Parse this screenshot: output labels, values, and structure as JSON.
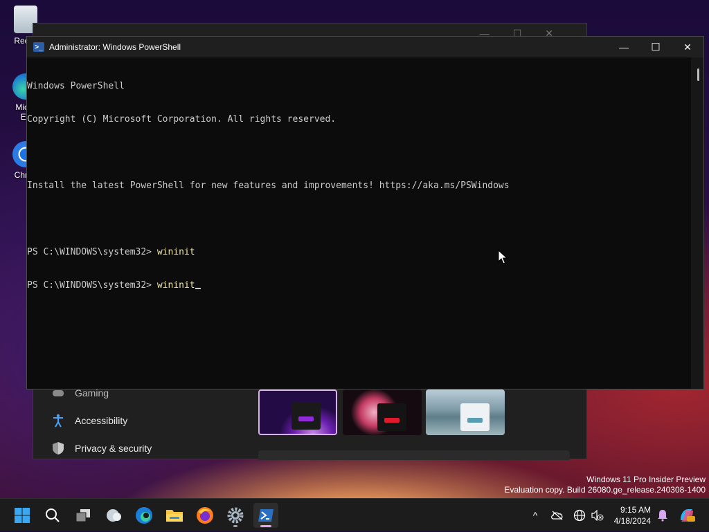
{
  "desktop": {
    "icons": [
      {
        "label": "Recyc"
      },
      {
        "label": "Micro"
      },
      {
        "label": "Ed"
      },
      {
        "label": "Chron"
      }
    ]
  },
  "settings_window": {
    "nav_items": [
      {
        "label": "Gaming",
        "icon": "gaming-icon"
      },
      {
        "label": "Accessibility",
        "icon": "accessibility-icon"
      },
      {
        "label": "Privacy & security",
        "icon": "shield-icon"
      }
    ],
    "controls": [
      "—",
      "☐",
      "✕"
    ]
  },
  "powershell": {
    "title": "Administrator: Windows PowerShell",
    "lines": [
      {
        "text": "Windows PowerShell",
        "cmd": ""
      },
      {
        "text": "Copyright (C) Microsoft Corporation. All rights reserved.",
        "cmd": ""
      },
      {
        "text": "",
        "cmd": ""
      },
      {
        "text": "Install the latest PowerShell for new features and improvements! https://aka.ms/PSWindows",
        "cmd": ""
      },
      {
        "text": "",
        "cmd": ""
      },
      {
        "text": "PS C:\\WINDOWS\\system32> ",
        "cmd": "wininit"
      },
      {
        "text": "PS C:\\WINDOWS\\system32> ",
        "cmd": "wininit"
      }
    ],
    "controls": {
      "minimize": "—",
      "maximize": "☐",
      "close": "✕"
    }
  },
  "watermark": {
    "line1": "Windows 11 Pro Insider Preview",
    "line2": "Evaluation copy. Build 26080.ge_release.240308-1400"
  },
  "taskbar": {
    "apps": [
      {
        "name": "start-button",
        "icon": "windows-logo-icon"
      },
      {
        "name": "search-button",
        "icon": "search-icon"
      },
      {
        "name": "task-view-button",
        "icon": "task-view-icon"
      },
      {
        "name": "widgets-button",
        "icon": "weather-icon"
      },
      {
        "name": "edge-button",
        "icon": "edge-icon"
      },
      {
        "name": "file-explorer-button",
        "icon": "folder-icon"
      },
      {
        "name": "firefox-button",
        "icon": "firefox-icon"
      },
      {
        "name": "settings-button",
        "icon": "gear-icon"
      },
      {
        "name": "powershell-button",
        "icon": "powershell-icon"
      }
    ],
    "tray": {
      "chevron": "^",
      "time": "9:15 AM",
      "date": "4/18/2024"
    }
  }
}
